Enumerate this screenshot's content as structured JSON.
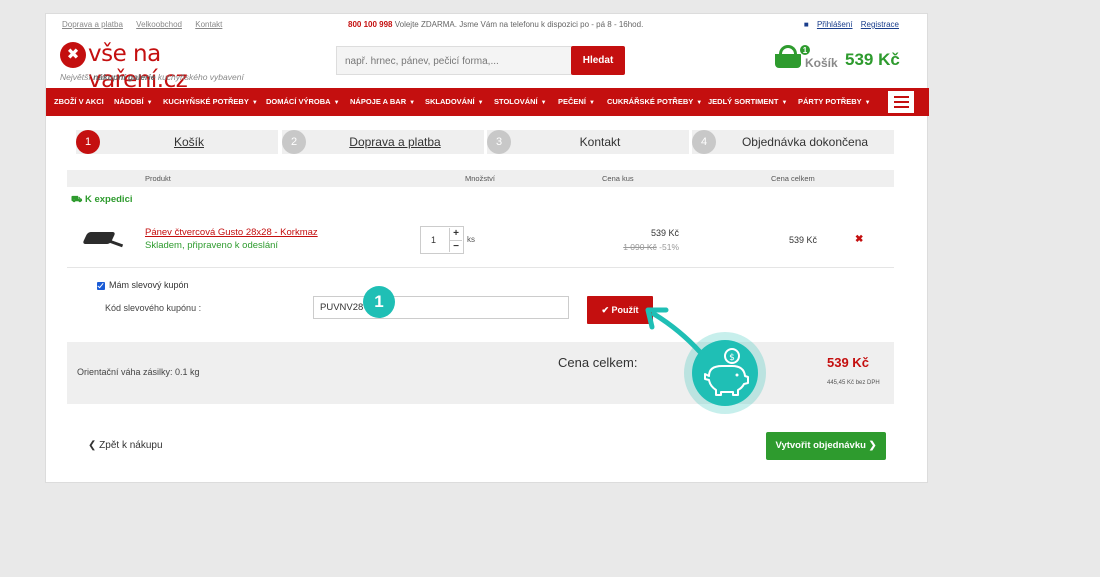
{
  "topbar": {
    "links": [
      "Doprava a platba",
      "Velkoobchod",
      "Kontakt"
    ],
    "phone": "800 100 998",
    "phone_text": "Volejte ZDARMA. Jsme Vám na telefonu k dispozici po - pá 8 - 16hod.",
    "login": "Přihlášení",
    "register": "Registrace"
  },
  "header": {
    "logo_text": "vše na vaření.cz",
    "tagline_prefix": "Největší",
    "tagline_bold": "nákupní galerie",
    "tagline_suffix": "kuchyňského vybavení",
    "search_placeholder": "např. hrnec, pánev, pečicí forma,...",
    "search_button": "Hledat",
    "cart_count": "1",
    "cart_label": "Košík",
    "cart_price": "539 Kč"
  },
  "nav": {
    "items": [
      "ZBOŽÍ V AKCI",
      "NÁDOBÍ",
      "KUCHYŇSKÉ POTŘEBY",
      "DOMÁCÍ VÝROBA",
      "NÁPOJE A BAR",
      "SKLADOVÁNÍ",
      "STOLOVÁNÍ",
      "PEČENÍ",
      "CUKRÁŘSKÉ POTŘEBY",
      "JEDLÝ SORTIMENT",
      "PÁRTY POTŘEBY"
    ]
  },
  "steps": [
    {
      "num": "1",
      "label": "Košík"
    },
    {
      "num": "2",
      "label": "Doprava a platba"
    },
    {
      "num": "3",
      "label": "Kontakt"
    },
    {
      "num": "4",
      "label": "Objednávka dokončena"
    }
  ],
  "table": {
    "headers": {
      "product": "Produkt",
      "qty": "Množství",
      "unit_price": "Cena kus",
      "total": "Cena celkem"
    },
    "availability": "K expedici",
    "item": {
      "name": "Pánev čtvercová Gusto 28x28 - Korkmaz",
      "stock": "Skladem, připraveno k odeslání",
      "qty": "1",
      "unit": "ks",
      "price": "539 Kč",
      "old_price": "1 090 Kč",
      "discount": "-51%",
      "total": "539 Kč"
    }
  },
  "coupon": {
    "checkbox_label": "Mám slevový kupón",
    "field_label": "Kód slevového kupónu :",
    "value": "PUVNV28",
    "apply": "Použít"
  },
  "summary": {
    "weight": "Orientační váha zásilky: 0.1 kg",
    "total_label": "Cena celkem:",
    "total_price": "539 Kč",
    "vat": "445,45 Kč bez DPH"
  },
  "footer": {
    "back": "Zpět k nákupu",
    "order": "Vytvořit objednávku"
  },
  "annotation": {
    "badge": "1"
  },
  "colors": {
    "brand_red": "#c40f0f",
    "green": "#2e9b2e",
    "teal": "#1fbfb5"
  }
}
